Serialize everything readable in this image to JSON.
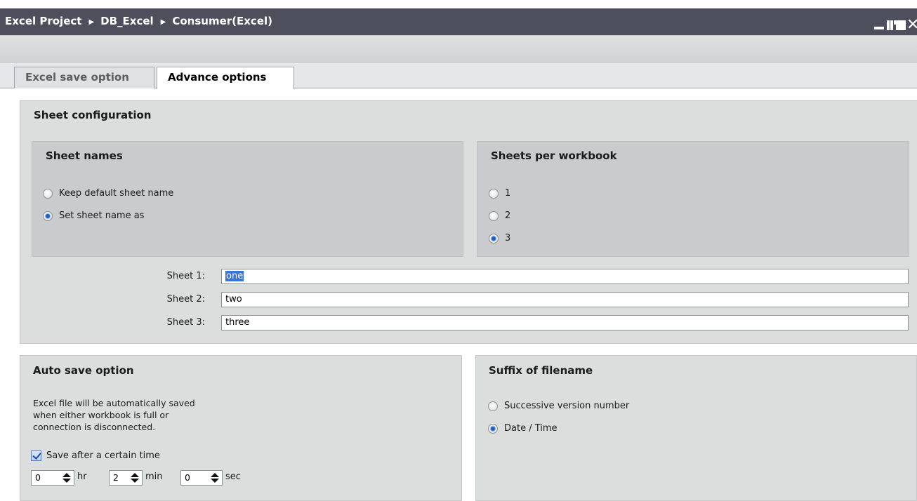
{
  "window": {
    "breadcrumb": [
      "Excel Project",
      "DB_Excel",
      "Consumer(Excel)"
    ],
    "controls": [
      "minimize-icon",
      "tile-icon",
      "maximize-icon",
      "close-icon"
    ],
    "close_glyph": "✕"
  },
  "tabs": [
    {
      "label": "Excel save option",
      "active": false
    },
    {
      "label": "Advance options",
      "active": true
    }
  ],
  "sheet_config": {
    "title": "Sheet configuration",
    "sheet_names": {
      "title": "Sheet names",
      "options": [
        {
          "label": "Keep default sheet name",
          "selected": false
        },
        {
          "label": "Set sheet name as",
          "selected": true
        }
      ]
    },
    "sheets_per_workbook": {
      "title": "Sheets per workbook",
      "options": [
        {
          "label": "1",
          "selected": false
        },
        {
          "label": "2",
          "selected": false
        },
        {
          "label": "3",
          "selected": true
        }
      ]
    },
    "sheets": [
      {
        "label": "Sheet 1:",
        "value": "one"
      },
      {
        "label": "Sheet 2:",
        "value": "two"
      },
      {
        "label": "Sheet 3:",
        "value": "three"
      }
    ]
  },
  "auto_save": {
    "title": "Auto save option",
    "description": [
      "Excel file will be automatically saved",
      "when either workbook is full or",
      "connection is disconnected."
    ],
    "checkbox_label": "Save after a certain time",
    "checked": true,
    "hours": "0",
    "hours_unit": "hr",
    "minutes": "2",
    "minutes_unit": "min",
    "seconds": "0",
    "seconds_unit": "sec"
  },
  "suffix": {
    "title": "Suffix of filename",
    "options": [
      {
        "label": "Successive version number",
        "selected": false
      },
      {
        "label": "Date / Time",
        "selected": true
      }
    ]
  },
  "colors": {
    "titlebar": "#4d4f5c",
    "radio_selected": "#1f5fbf",
    "text_selection": "#3875d7"
  }
}
